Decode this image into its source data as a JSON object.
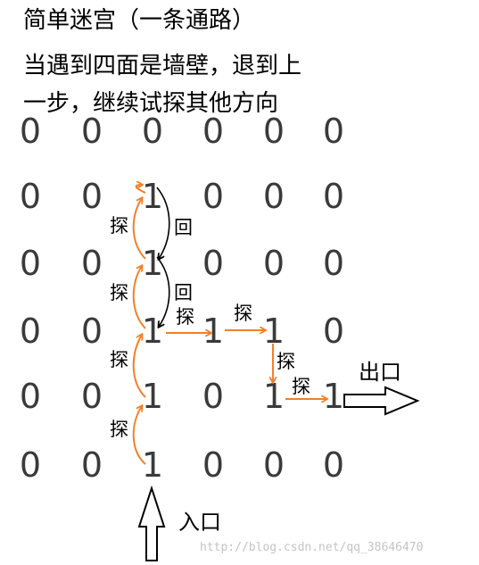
{
  "title": {
    "line1": "简单迷宫（一条通路）",
    "line2": "当遇到四面是墙壁，退到上",
    "line3": "一步，继续试探其他方向"
  },
  "maze": {
    "rows": [
      [
        "0",
        "0",
        "0",
        "0",
        "0",
        "0"
      ],
      [
        "0",
        "0",
        "1",
        "0",
        "0",
        "0"
      ],
      [
        "0",
        "0",
        "1",
        "0",
        "0",
        "0"
      ],
      [
        "0",
        "0",
        "1",
        "1",
        "1",
        "0"
      ],
      [
        "0",
        "0",
        "1",
        "0",
        "1",
        "1"
      ],
      [
        "0",
        "0",
        "1",
        "0",
        "0",
        "0"
      ]
    ]
  },
  "labels": {
    "probe": "探",
    "back": "回",
    "exit": "出口",
    "entrance": "入口"
  },
  "watermark": "http://blog.csdn.net/qq_38646470",
  "colors": {
    "probe_arrow": "#f0802a",
    "back_arrow": "#000000",
    "digit": "#3a3a3a"
  }
}
